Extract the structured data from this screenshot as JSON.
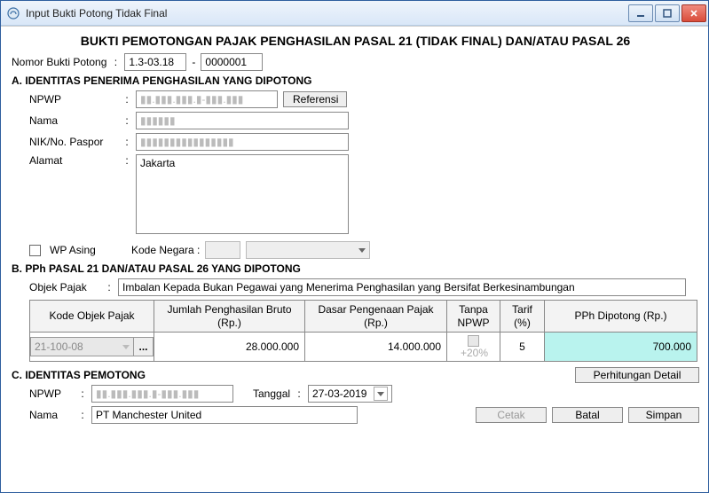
{
  "window": {
    "title": "Input Bukti Potong Tidak Final"
  },
  "header": {
    "main_title": "BUKTI PEMOTONGAN PAJAK PENGHASILAN PASAL 21 (TIDAK FINAL) DAN/ATAU PASAL 26",
    "nomor_label": "Nomor Bukti Potong",
    "nomor_part1": "1.3-03.18",
    "nomor_sep": "-",
    "nomor_part2": "0000001"
  },
  "sectionA": {
    "heading": "A.  IDENTITAS PENERIMA PENGHASILAN YANG DIPOTONG",
    "npwp_label": "NPWP",
    "npwp_value": "▮▮.▮▮▮.▮▮▮.▮-▮▮▮.▮▮▮",
    "referensi_label": "Referensi",
    "nama_label": "Nama",
    "nama_value": "▮▮▮▮▮▮",
    "nik_label": "NIK/No. Paspor",
    "nik_value": "▮▮▮▮▮▮▮▮▮▮▮▮▮▮▮▮",
    "alamat_label": "Alamat",
    "alamat_value": "Jakarta",
    "wp_asing_label": "WP Asing",
    "kode_negara_label": "Kode Negara :",
    "kode_negara_value": ""
  },
  "sectionB": {
    "heading": "B.  PPh PASAL 21 DAN/ATAU PASAL 26 YANG DIPOTONG",
    "objek_label": "Objek Pajak",
    "objek_value": "Imbalan Kepada Bukan Pegawai yang Menerima Penghasilan yang Bersifat Berkesinambungan",
    "cols": {
      "kode": "Kode Objek Pajak",
      "bruto": "Jumlah Penghasilan Bruto (Rp.)",
      "dasar": "Dasar Pengenaan Pajak (Rp.)",
      "tanpa": "Tanpa NPWP",
      "tarif": "Tarif (%)",
      "pph": "PPh Dipotong (Rp.)"
    },
    "row": {
      "kode": "21-100-08",
      "bruto": "28.000.000",
      "dasar": "14.000.000",
      "tanpa_pct": "+20%",
      "tarif": "5",
      "pph": "700.000"
    },
    "detail_btn": "Perhitungan Detail"
  },
  "sectionC": {
    "heading": "C.  IDENTITAS PEMOTONG",
    "npwp_label": "NPWP",
    "npwp_value": "▮▮.▮▮▮.▮▮▮.▮-▮▮▮.▮▮▮",
    "tanggal_label": "Tanggal",
    "tanggal_value": "27-03-2019",
    "nama_label": "Nama",
    "nama_value": "PT Manchester United"
  },
  "footer": {
    "cetak": "Cetak",
    "batal": "Batal",
    "simpan": "Simpan"
  }
}
